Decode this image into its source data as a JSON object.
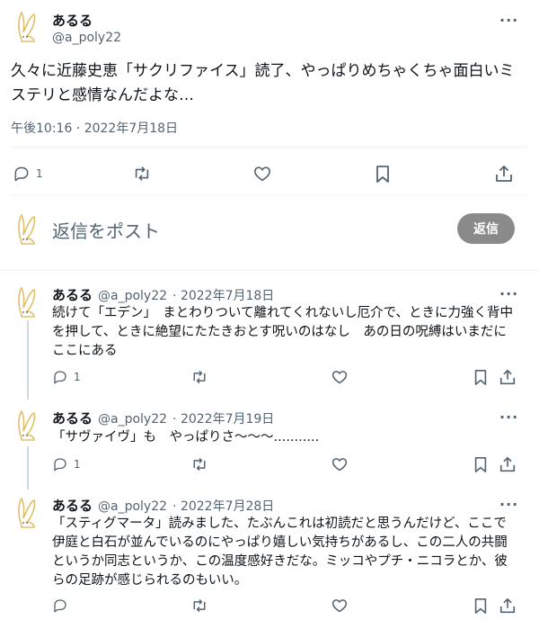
{
  "tweet": {
    "author_name": "あるる",
    "author_handle": "@a_poly22",
    "text": "久々に近藤史恵「サクリファイス」読了、やっぱりめちゃくちゃ面白いミステリと感情なんだよな…",
    "timestamp": "午後10:16 · 2022年7月18日",
    "reply_count": "1",
    "more_glyph": "···"
  },
  "compose": {
    "placeholder": "返信をポスト",
    "button_label": "返信"
  },
  "replies": [
    {
      "name": "あるる",
      "handle": "@a_poly22",
      "date": "· 2022年7月18日",
      "text": "続けて「エデン」　まとわりついて離れてくれないし厄介で、ときに力強く背中を押して、ときに絶望にたたきおとす呪いのはなし　あの日の呪縛はいまだにここにある",
      "reply_count": "1"
    },
    {
      "name": "あるる",
      "handle": "@a_poly22",
      "date": "· 2022年7月19日",
      "text": "「サヴァイヴ」も　やっぱりさ〜〜〜...........",
      "reply_count": "1"
    },
    {
      "name": "あるる",
      "handle": "@a_poly22",
      "date": "· 2022年7月28日",
      "text": "「スティグマータ」読みました、たぶんこれは初読だと思うんだけど、ここで伊庭と白石が並んでいるのにやっぱり嬉しい気持ちがあるし、この二人の共闘というか同志というか、この温度感好きだな。ミッコやプチ・ニコラとか、彼らの足跡が感じられるのもいい。",
      "reply_count": ""
    }
  ],
  "colors": {
    "text": "#0f1419",
    "secondary": "#536471",
    "avatar_accent": "#e8c96a",
    "reply_button": "#8a8a8a"
  }
}
